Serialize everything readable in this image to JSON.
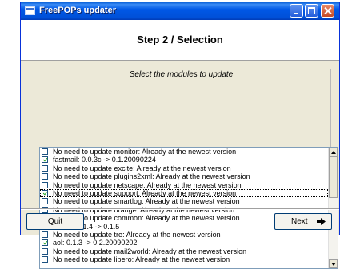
{
  "window": {
    "title": "FreePOPs updater"
  },
  "header": {
    "step_title": "Step 2 / Selection"
  },
  "modules_group": {
    "label": "Select the modules to update",
    "items": [
      {
        "checked": false,
        "label": "No need to update monitor: Already at the newest version"
      },
      {
        "checked": true,
        "label": "fastmail: 0.0.3c -> 0.1.20090224"
      },
      {
        "checked": false,
        "label": "No need to update excite: Already at the newest version"
      },
      {
        "checked": false,
        "label": "No need to update plugins2xml: Already at the newest version"
      },
      {
        "checked": false,
        "label": "No need to update netscape: Already at the newest version"
      },
      {
        "checked": true,
        "label": "No need to update support: Already at the newest version"
      },
      {
        "checked": false,
        "label": "No need to update smartlog: Already at the newest version"
      },
      {
        "checked": false,
        "label": "No need to update orange: Already at the newest version"
      },
      {
        "checked": false,
        "label": "No need to update common: Already at the newest version"
      },
      {
        "checked": true,
        "label": "mimer: 0.1.4 -> 0.1.5"
      },
      {
        "checked": false,
        "label": "No need to update tre: Already at the newest version"
      },
      {
        "checked": true,
        "label": "aol: 0.1.3 -> 0.2.20090202"
      },
      {
        "checked": false,
        "label": "No need to update mail2world: Already at the newest version"
      },
      {
        "checked": false,
        "label": "No need to update libero: Already at the newest version"
      }
    ]
  },
  "buttons": {
    "quit": "Quit",
    "next": "Next"
  },
  "icons": {
    "app": "app-window-icon",
    "next": "arrow-right-icon"
  },
  "colors": {
    "titlebar": "#0058e6",
    "window_bg": "#ece9d8",
    "check": "#21a121"
  }
}
